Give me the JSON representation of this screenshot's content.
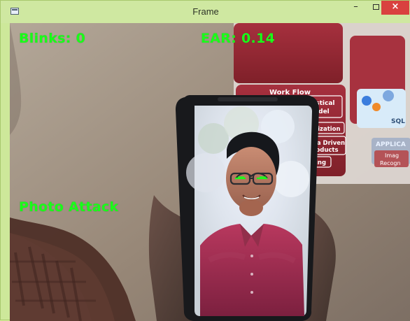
{
  "window": {
    "title": "Frame",
    "minimize_glyph": "–",
    "maximize_glyph": "□",
    "close_glyph": "×",
    "accent_color": "#cde89a",
    "close_color": "#d9413f"
  },
  "overlay": {
    "blinks_text": "Blinks: 0",
    "ear_text": "EAR: 0.14",
    "status_text": "Photo Attack",
    "text_color": "#19ff19"
  },
  "scene": {
    "poster_heading_1": "Work Flow",
    "poster_box_1": "Statistical",
    "poster_box_1b": "Model",
    "poster_box_2": "Visualization",
    "poster_box_3": "Data Driven",
    "poster_box_3b": "Products",
    "poster_box_4": "arning",
    "poster_label_r1": "SQL",
    "poster_label_r2": "APPLICA",
    "poster_label_r3": "Imag",
    "poster_label_r4": "Recogn"
  }
}
